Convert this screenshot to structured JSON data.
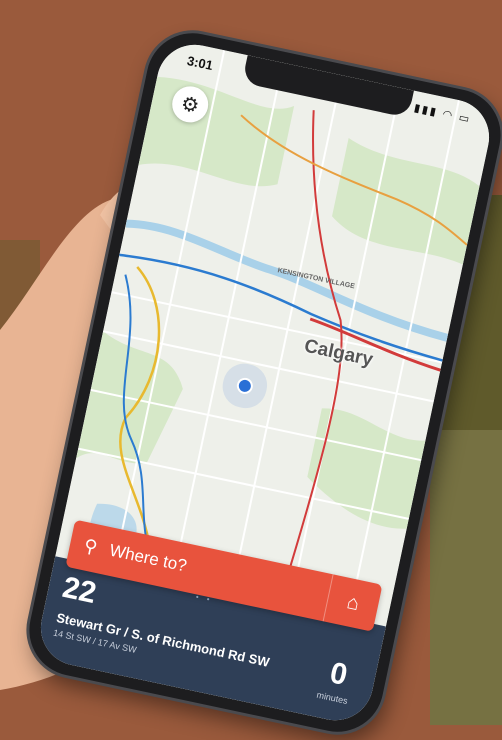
{
  "status_bar": {
    "time": "3:01",
    "icons": "▮▮▮ ◠ ▭"
  },
  "map": {
    "city_label": "Calgary",
    "area_label": "KENSINGTON VILLAGE"
  },
  "search": {
    "placeholder": "Where to?"
  },
  "arrival": {
    "route_number": "22",
    "stop_name": "Stewart Gr / S. of Richmond Rd SW",
    "stop_subtext": "14 St SW / 17 Av SW",
    "minutes_value": "0",
    "minutes_label": "minutes"
  },
  "icons": {
    "settings": "gear-icon",
    "search": "search-icon",
    "home": "home-icon"
  },
  "colors": {
    "accent": "#e8533d",
    "panel": "#2f3f57",
    "user_dot": "#2a6fd6"
  }
}
